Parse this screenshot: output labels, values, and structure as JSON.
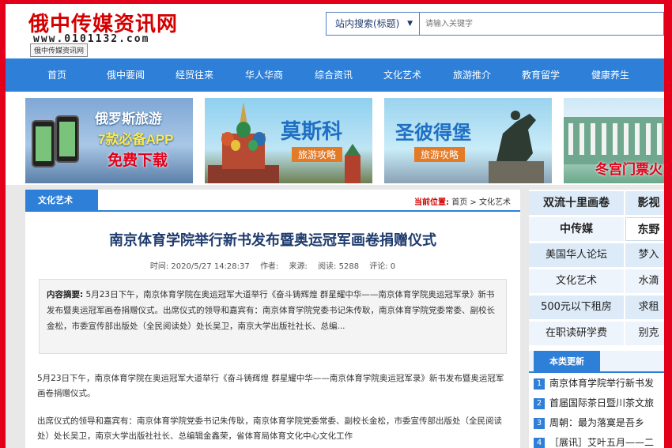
{
  "header": {
    "logo": "俄中传媒资讯网",
    "url": "www.0101132.com",
    "tooltip": "俄中传媒资讯网",
    "search_scope": "站内搜索(标题)",
    "search_placeholder": "请输入关键字"
  },
  "nav": [
    "首页",
    "俄中要闻",
    "经贸往来",
    "华人华商",
    "综合资讯",
    "文化艺术",
    "旅游推介",
    "教育留学",
    "健康养生"
  ],
  "banners": [
    {
      "title": "俄罗斯旅游",
      "line2": "7款必备APP",
      "line3": "免费下载"
    },
    {
      "title": "莫斯科",
      "sub": "旅游攻略"
    },
    {
      "title": "圣彼得堡",
      "sub": "旅游攻略"
    },
    {
      "title": "冬宫门票火"
    }
  ],
  "article": {
    "category": "文化艺术",
    "location_label": "当前位置:",
    "breadcrumb_home": "首页",
    "breadcrumb_sep": ">",
    "breadcrumb_current": "文化艺术",
    "title": "南京体育学院举行新书发布暨奥运冠军画卷捐赠仪式",
    "time": "时间: 2020/5/27 14:28:37",
    "author": "作者:",
    "source": "来源:",
    "views": "阅读: 5288",
    "comments": "评论: 0",
    "summary_label": "内容摘要:",
    "summary": "5月23日下午，南京体育学院在奥运冠军大道举行《奋斗铸辉煌 群星耀中华——南京体育学院奥运冠军录》新书发布暨奥运冠军画卷捐赠仪式。出席仪式的领导和嘉宾有：南京体育学院党委书记朱传耿，南京体育学院党委常委、副校长金松，市委宣传部出版处（全民阅读处）处长吴卫，南京大学出版社社长、总编...",
    "para1": "5月23日下午，南京体育学院在奥运冠军大道举行《奋斗铸辉煌 群星耀中华——南京体育学院奥运冠军录》新书发布暨奥运冠军画卷捐赠仪式。",
    "para2": "出席仪式的领导和嘉宾有：南京体育学院党委书记朱传耿，南京体育学院党委常委、副校长金松，市委宣传部出版处（全民阅读处）处长吴卫，南京大学出版社社长、总编辑金鑫荣，省体育局体育文化中心文化工作"
  },
  "sidebar": {
    "cells": [
      "双流十里画卷",
      "影视",
      "中传媒",
      "东野",
      "美国华人论坛",
      "梦入",
      "文化艺术",
      "水滴",
      "500元以下租房",
      "求租",
      "在职读研学费",
      "别克"
    ],
    "latest_label": "本类更新",
    "latest": [
      {
        "num": "1",
        "text": "南京体育学院举行新书发"
      },
      {
        "num": "2",
        "text": "首届国际茶日暨川茶文旅"
      },
      {
        "num": "3",
        "text": "周朝：最为落寞是吾乡"
      },
      {
        "num": "4",
        "text": "［展讯］艾叶五月——二"
      }
    ]
  },
  "colors": {
    "accent": "#2d7fd8",
    "brand_red": "#d40000",
    "frame": "#e2001a"
  }
}
